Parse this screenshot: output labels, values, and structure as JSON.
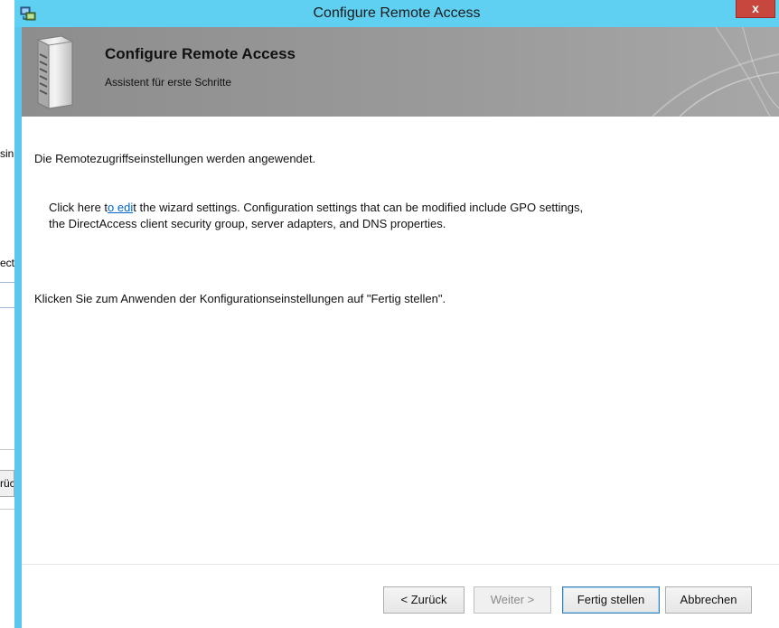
{
  "background_window": {
    "fragment_1": "sin",
    "fragment_2": "ect",
    "button_fragment": "rück"
  },
  "window": {
    "title": "Configure Remote Access",
    "close_label": "x"
  },
  "header": {
    "title": "Configure Remote Access",
    "subtitle": "Assistent für erste Schritte"
  },
  "content": {
    "status_text": "Die Remotezugriffseinstellungen werden angewendet.",
    "edit_prefix": "Click here t",
    "edit_link": "o edi",
    "edit_suffix": "t the wizard settings. Configuration settings that can be modified include GPO settings,",
    "edit_line2": "the DirectAccess client security group, server adapters, and DNS properties.",
    "finish_hint": "Klicken Sie zum Anwenden der Konfigurationseinstellungen auf \"Fertig stellen\"."
  },
  "buttons": {
    "back": "< Zurück",
    "next": "Weiter >",
    "finish": "Fertig stellen",
    "cancel": "Abbrechen"
  },
  "colors": {
    "titlebar": "#5fd0f2",
    "close": "#c7463d",
    "link": "#0066cc",
    "header_bg": "#9b9b9b"
  }
}
